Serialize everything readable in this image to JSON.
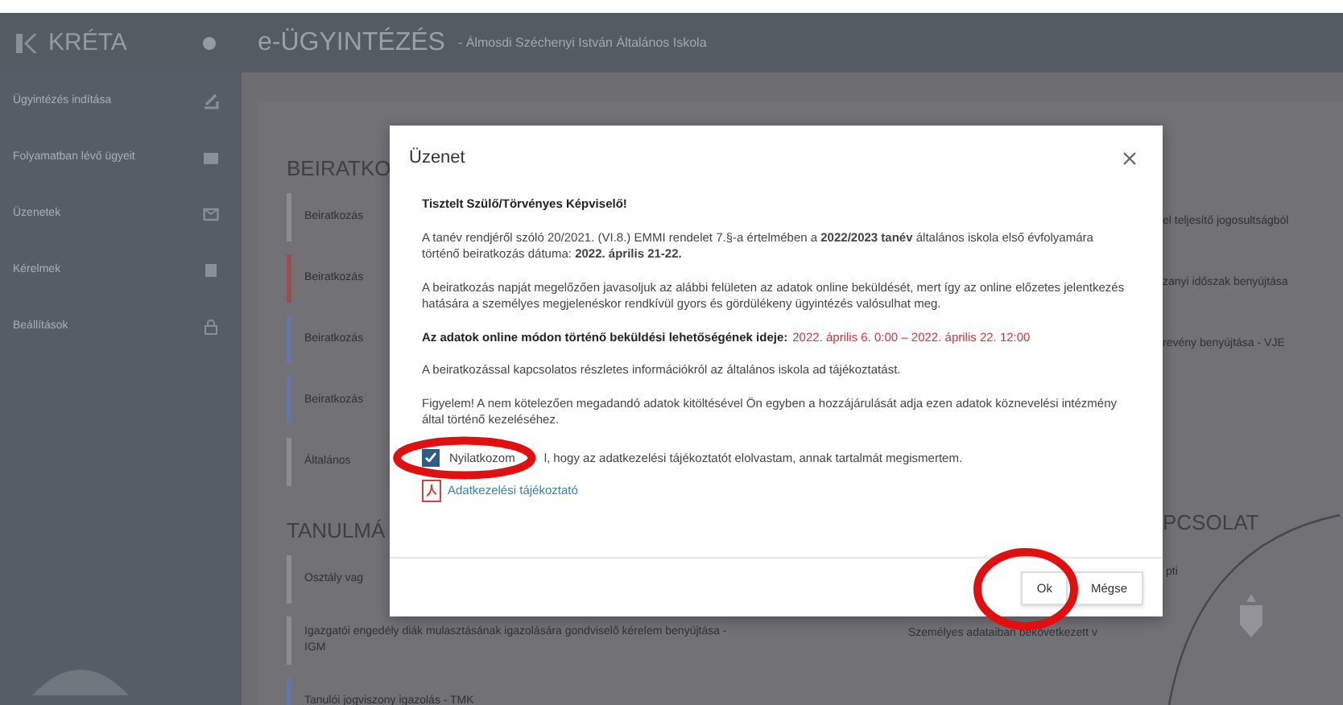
{
  "header": {
    "logo": "KRÉTA",
    "title": "e-ÜGYINTÉZÉS",
    "subtitle": "- Álmosdi Széchenyi István Általános Iskola"
  },
  "sidebar": {
    "items": [
      {
        "label": "Ügyintézés indítása"
      },
      {
        "label": "Folyamatban lévő ügyeit"
      },
      {
        "label": "Üzenetek"
      },
      {
        "label": "Kérelmek"
      },
      {
        "label": "Beállítások"
      }
    ]
  },
  "main": {
    "left_sections": [
      {
        "heading": "BEIRATKO",
        "items": [
          {
            "label": "Beiratkozás",
            "color": "#8a8d92"
          },
          {
            "label": "Beiratkozás",
            "color": "#9a4f55"
          },
          {
            "label": "Beiratkozás",
            "color": "#6a74a0"
          },
          {
            "label": "Beiratkozás",
            "color": "#6a74a0"
          },
          {
            "label": "Általános",
            "color": "#8a8d92"
          }
        ]
      },
      {
        "heading": "TANULMÁ",
        "items": [
          {
            "label": "Osztály vag",
            "color": "#8a8d92"
          },
          {
            "label": "Igazgatói engedély diák mulasztásának igazolására gondviselő kérelem benyújtása - IGM",
            "color": "#8a8d92"
          },
          {
            "label": "Tanulói jogviszony igazolás - TMK",
            "color": "#6a74a0"
          }
        ]
      }
    ],
    "right_top": [
      "el teljesítő jogosultságból",
      "zanyi időszak benyújtása",
      "revény benyújtása - VJE"
    ],
    "right_heading": "PCSOLAT",
    "right_bottom": [
      "pti",
      "Személyes adataiban bekövetkezett v"
    ]
  },
  "dialog": {
    "title": "Üzenet",
    "body": [
      {
        "kind": "heading",
        "text": "Tisztelt Szülő/Törvényes Képviselő!"
      },
      {
        "kind": "text",
        "text": "A tanév rendjéről szóló 20/2021. (VI.8.) EMMI rendelet 7.§-a értelmében a **2022/2023 tanév** általános iskola első évfolyamára történő beiratkozás dátuma: **2022. április 21-22.**"
      },
      {
        "kind": "text",
        "text": "A beiratkozás napját megelőzően javasoljuk az alábbi felületen az adatok online beküldését, mert így az online előzetes jelentkezés hatására a személyes megjelenéskor rendkívül gyors és gördülékeny ügyintézés valósulhat meg."
      },
      {
        "kind": "deadline",
        "label": "Az adatok online módon történő beküldési lehetőségének ideje:",
        "value": "2022. április 6. 0:00 – 2022. április 22. 12:00"
      },
      {
        "kind": "text",
        "text": "A beiratkozással kapcsolatos részletes információkról az általános iskola ad tájékoztatást."
      },
      {
        "kind": "text",
        "text": "Figyelem! A nem kötelezően megadandó adatok kitöltésével Ön egyben a hozzájárulását adja ezen adatok köznevelési intézmény által történő kezeléséhez."
      }
    ],
    "consent": {
      "label": "Nyilatkozom",
      "label_rest": "l, hogy az adatkezelési tájékoztatót elolvastam, annak tartalmát megismertem.",
      "checked": true
    },
    "attachment": "Adatkezelési tájékoztató",
    "buttons": [
      "Ok",
      "Mégse"
    ]
  }
}
